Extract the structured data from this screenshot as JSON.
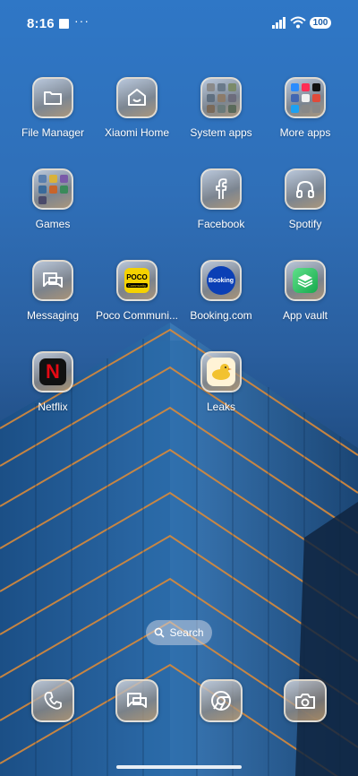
{
  "status_bar": {
    "time": "8:16",
    "more": "···",
    "battery": "100"
  },
  "apps": {
    "file_manager": "File Manager",
    "xiaomi_home": "Xiaomi Home",
    "system_apps": "System apps",
    "more_apps": "More apps",
    "games": "Games",
    "facebook": "Facebook",
    "spotify": "Spotify",
    "messaging": "Messaging",
    "poco_community": "Poco Communi...",
    "booking": "Booking.com",
    "app_vault": "App vault",
    "netflix": "Netflix",
    "leaks": "Leaks"
  },
  "logos": {
    "poco": "POCO",
    "poco_sub": "Community",
    "booking": "Booking",
    "netflix": "N"
  },
  "search": {
    "label": "Search"
  },
  "dock": {
    "items": [
      "phone-icon",
      "messaging-icon",
      "chrome-icon",
      "camera-icon"
    ]
  },
  "colors": {
    "sky": "#2f77c6",
    "building_accent": "#d98a3a"
  }
}
